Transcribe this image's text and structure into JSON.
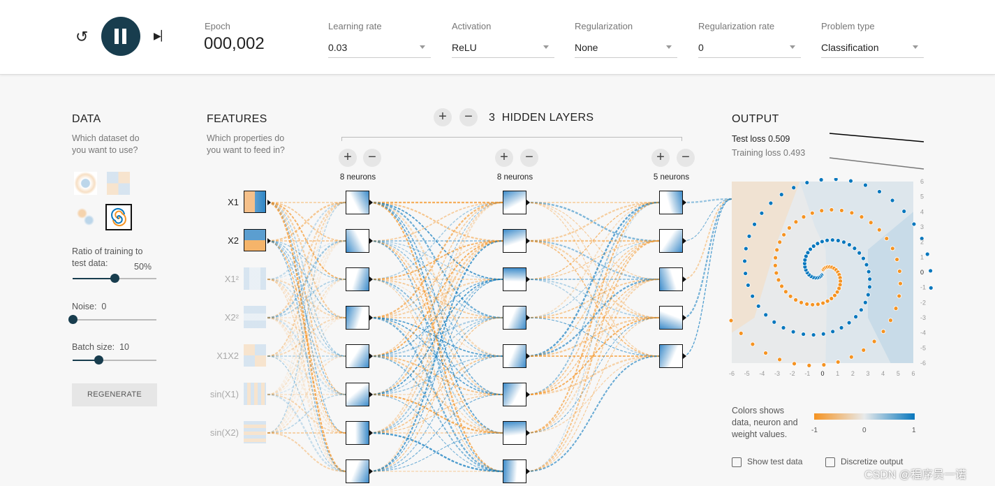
{
  "header": {
    "reset_icon": "reset-icon",
    "play_pause_icon": "pause-icon",
    "step_icon": "step-icon",
    "epoch_label": "Epoch",
    "epoch_value": "000,002",
    "controls": [
      {
        "label": "Learning rate",
        "value": "0.03"
      },
      {
        "label": "Activation",
        "value": "ReLU"
      },
      {
        "label": "Regularization",
        "value": "None"
      },
      {
        "label": "Regularization rate",
        "value": "0"
      },
      {
        "label": "Problem type",
        "value": "Classification"
      }
    ]
  },
  "data": {
    "title": "DATA",
    "subtitle": "Which dataset do you want to use?",
    "datasets": [
      "circle",
      "xor",
      "gaussian",
      "spiral"
    ],
    "selected_dataset": "spiral",
    "ratio_label": "Ratio of training to test data:",
    "ratio_value": "50%",
    "ratio": 50,
    "noise_label": "Noise:",
    "noise_value": "0",
    "noise": 0,
    "batch_label": "Batch size:",
    "batch_value": "10",
    "batch": 10,
    "regenerate": "REGENERATE"
  },
  "features": {
    "title": "FEATURES",
    "subtitle": "Which properties do you want to feed in?",
    "items": [
      {
        "label": "X1",
        "active": true
      },
      {
        "label": "X2",
        "active": true
      },
      {
        "label": "X1²",
        "active": false
      },
      {
        "label": "X2²",
        "active": false
      },
      {
        "label": "X1X2",
        "active": false
      },
      {
        "label": "sin(X1)",
        "active": false
      },
      {
        "label": "sin(X2)",
        "active": false
      }
    ]
  },
  "network": {
    "layers_count": "3",
    "layers_label": "HIDDEN LAYERS",
    "plus": "+",
    "minus": "−",
    "layers": [
      {
        "neurons": 8,
        "label": "8 neurons"
      },
      {
        "neurons": 8,
        "label": "8 neurons"
      },
      {
        "neurons": 5,
        "label": "5 neurons"
      }
    ]
  },
  "output": {
    "title": "OUTPUT",
    "test_loss": "Test loss 0.509",
    "training_loss": "Training loss 0.493",
    "axis_ticks": [
      "-6",
      "-5",
      "-4",
      "-3",
      "-2",
      "-1",
      "0",
      "1",
      "2",
      "3",
      "4",
      "5",
      "6"
    ],
    "legend_text": "Colors shows data, neuron and weight values.",
    "legend_ticks": [
      "-1",
      "0",
      "1"
    ],
    "show_test_data": "Show test data",
    "discretize_output": "Discretize output",
    "colors": {
      "negative": "#f59322",
      "positive": "#0877bd",
      "neutral": "#e8eaeb"
    }
  },
  "watermark": "CSDN @程序员一诺"
}
